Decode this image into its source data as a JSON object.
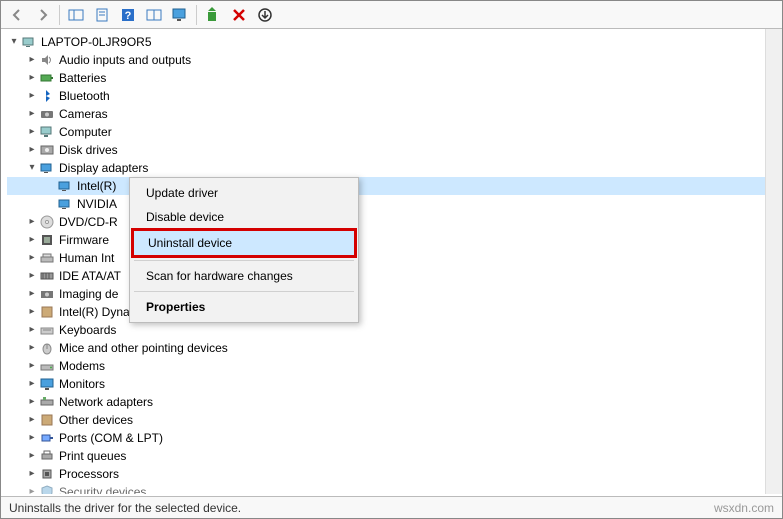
{
  "root_label": "LAPTOP-0LJR9OR5",
  "categories": [
    {
      "label": "Audio inputs and outputs",
      "expander": "right"
    },
    {
      "label": "Batteries",
      "expander": "right"
    },
    {
      "label": "Bluetooth",
      "expander": "right"
    },
    {
      "label": "Cameras",
      "expander": "right"
    },
    {
      "label": "Computer",
      "expander": "right"
    },
    {
      "label": "Disk drives",
      "expander": "right"
    },
    {
      "label": "Display adapters",
      "expander": "down",
      "children": [
        {
          "label": "Intel(R)",
          "selected": true
        },
        {
          "label": "NVIDIA"
        }
      ]
    },
    {
      "label": "DVD/CD-R",
      "expander": "right",
      "truncated": true
    },
    {
      "label": "Firmware",
      "expander": "right",
      "truncated": true
    },
    {
      "label": "Human Int",
      "expander": "right",
      "truncated": true
    },
    {
      "label": "IDE ATA/AT",
      "expander": "right",
      "truncated": true
    },
    {
      "label": "Imaging de",
      "expander": "right",
      "truncated": true
    },
    {
      "label": "Intel(R) Dynamic Platform and Thermal Framework",
      "expander": "right"
    },
    {
      "label": "Keyboards",
      "expander": "right"
    },
    {
      "label": "Mice and other pointing devices",
      "expander": "right"
    },
    {
      "label": "Modems",
      "expander": "right"
    },
    {
      "label": "Monitors",
      "expander": "right"
    },
    {
      "label": "Network adapters",
      "expander": "right"
    },
    {
      "label": "Other devices",
      "expander": "right"
    },
    {
      "label": "Ports (COM & LPT)",
      "expander": "right"
    },
    {
      "label": "Print queues",
      "expander": "right"
    },
    {
      "label": "Processors",
      "expander": "right"
    },
    {
      "label": "Security devices",
      "expander": "right"
    }
  ],
  "context_menu": {
    "items": [
      {
        "label": "Update driver"
      },
      {
        "label": "Disable device"
      },
      {
        "label": "Uninstall device",
        "highlighted": true,
        "redbox": true
      },
      {
        "kind": "sep"
      },
      {
        "label": "Scan for hardware changes"
      },
      {
        "kind": "sep"
      },
      {
        "label": "Properties",
        "bold": true
      }
    ]
  },
  "statusbar": {
    "text": "Uninstalls the driver for the selected device.",
    "watermark": "wsxdn.com"
  }
}
